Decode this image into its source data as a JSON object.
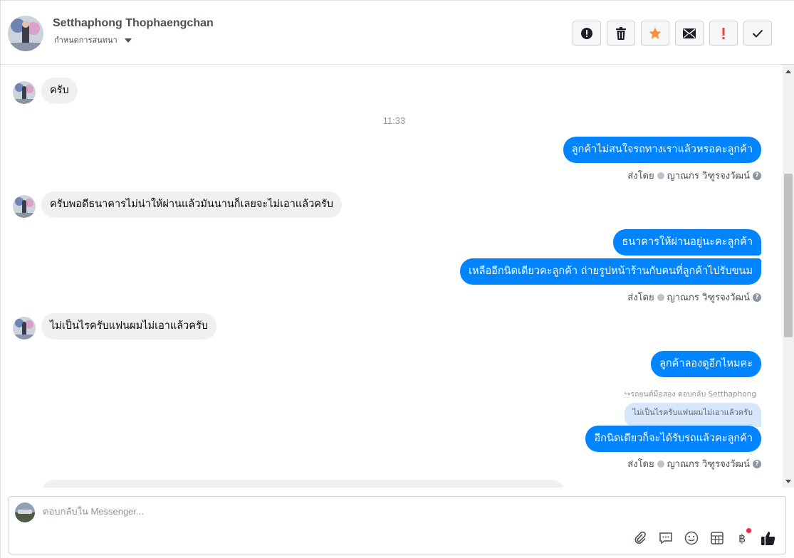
{
  "header": {
    "name": "Setthaphong Thophaengchan",
    "assign_label": "กำหนดการสนทนา",
    "actions": [
      {
        "icon": "alert-circle-icon",
        "label": "Mark as spam"
      },
      {
        "icon": "trash-icon",
        "label": "Delete"
      },
      {
        "icon": "star-icon",
        "label": "Star"
      },
      {
        "icon": "envelope-icon",
        "label": "Mark unread"
      },
      {
        "icon": "exclamation-icon",
        "label": "Follow up"
      },
      {
        "icon": "check-icon",
        "label": "Done"
      }
    ]
  },
  "conversation": {
    "messages": [
      {
        "dir": "in",
        "text": "ครับ"
      },
      {
        "dir": "timestamp",
        "text": "11:33"
      },
      {
        "dir": "out",
        "text": "ลูกค้าไม่สนใจรถทางเราแล้วหรอคะลูกค้า"
      },
      {
        "dir": "sent",
        "prefix": "ส่งโดย",
        "agent": "ญาณกร วิฑูรจงวัฒน์"
      },
      {
        "dir": "in",
        "text": "ครับพอดีธนาคารไม่น่าให้ผ่านแล้วมันนานก็เลยจะไม่เอาแล้วครับ"
      },
      {
        "dir": "out",
        "text": "ธนาคารให้ผ่านอยู่นะคะลูกค้า"
      },
      {
        "dir": "out",
        "text": "เหลืออีกนิดเดียวคะลูกค้า ถ่ายรูปหน้าร้านกับคนที่ลูกค้าไปรับขนม"
      },
      {
        "dir": "sent",
        "prefix": "ส่งโดย",
        "agent": "ญาณกร วิฑูรจงวัฒน์"
      },
      {
        "dir": "in",
        "text": "ไม่เป็นไรครับแฟนผมไม่เอาแล้วครับ"
      },
      {
        "dir": "out",
        "text": "ลูกค้าลองดูอีกไหมคะ"
      },
      {
        "dir": "reply-meta",
        "text": "รถยนต์มือสอง ตอบกลับ Setthaphong"
      },
      {
        "dir": "quoted",
        "text": "ไม่เป็นไรครับแฟนผมไม่เอาแล้วครับ"
      },
      {
        "dir": "out",
        "text": "อีกนิดเดียวก็จะได้รับรถแล้วคะลูกค้า"
      },
      {
        "dir": "sent",
        "prefix": "ส่งโดย",
        "agent": "ญาณกร วิฑูรจงวัฒน์"
      }
    ]
  },
  "composer": {
    "placeholder": "ตอบกลับใน Messenger...",
    "tools": [
      "paperclip-icon",
      "speech-bubble-icon",
      "emoji-icon",
      "calendar-grid-icon",
      "baht-icon",
      "thumbs-up-icon"
    ]
  },
  "colors": {
    "outgoing": "#0084ff",
    "incoming": "#f0f0f0",
    "star": "#f7923b",
    "alert": "#fa3e3e"
  }
}
